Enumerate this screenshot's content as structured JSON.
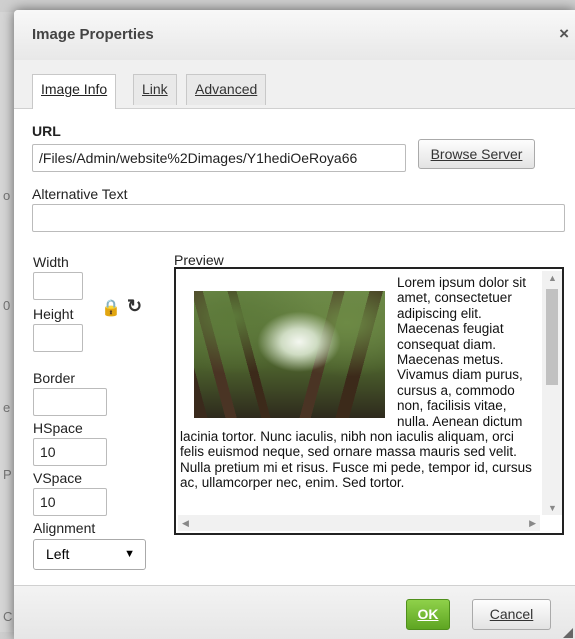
{
  "background": {
    "edge_chars": [
      "o",
      "0",
      "e",
      "P",
      "C"
    ]
  },
  "dialog": {
    "title": "Image Properties",
    "close_glyph": "×",
    "tabs": [
      {
        "label": "Image Info",
        "active": true
      },
      {
        "label": "Link",
        "active": false
      },
      {
        "label": "Advanced",
        "active": false
      }
    ],
    "url": {
      "label": "URL",
      "value": "/Files/Admin/website%2Dimages/Y1hediOeRoya66"
    },
    "browse_button": "Browse Server",
    "alt_text": {
      "label": "Alternative Text",
      "value": ""
    },
    "width": {
      "label": "Width",
      "value": ""
    },
    "height": {
      "label": "Height",
      "value": ""
    },
    "lock_glyph": "🔒",
    "reset_glyph": "↻",
    "border": {
      "label": "Border",
      "value": ""
    },
    "hspace": {
      "label": "HSpace",
      "value": "10"
    },
    "vspace": {
      "label": "VSpace",
      "value": "10"
    },
    "alignment": {
      "label": "Alignment",
      "value": "Left",
      "arrow": "▼"
    },
    "preview": {
      "label": "Preview",
      "text": "Lorem ipsum dolor sit amet, consectetuer adipiscing elit. Maecenas feugiat consequat diam. Maecenas metus. Vivamus diam purus, cursus a, commodo non, facilisis vitae, nulla. Aenean dictum lacinia tortor. Nunc iaculis, nibh non iaculis aliquam, orci felis euismod neque, sed ornare massa mauris sed velit. Nulla pretium mi et risus. Fusce mi pede, tempor id, cursus ac, ullamcorper nec, enim. Sed tortor."
    },
    "ok_button": "OK",
    "cancel_button": "Cancel"
  },
  "colors": {
    "ok_green": "#6cb52d",
    "title_text": "#444444"
  }
}
